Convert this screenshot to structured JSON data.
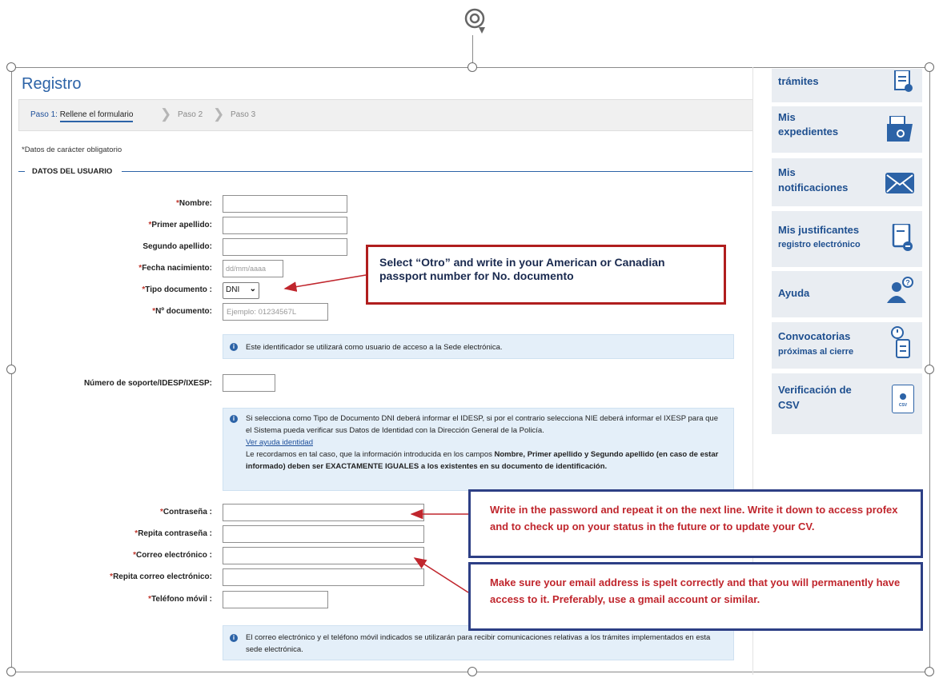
{
  "page_title": "Registro",
  "steps": {
    "step1_prefix": "Paso 1:",
    "step1_label": "Rellene el formulario",
    "step2": "Paso 2",
    "step3": "Paso 3"
  },
  "required_note": "*Datos de carácter obligatorio",
  "section_title": "DATOS DEL USUARIO",
  "fields": {
    "nombre": "Nombre:",
    "primer_apellido": "Primer apellido:",
    "segundo_apellido": "Segundo apellido:",
    "fecha_nacimiento": "Fecha nacimiento:",
    "fecha_placeholder": "dd/mm/aaaa",
    "tipo_documento": "Tipo documento :",
    "tipo_documento_value": "DNI",
    "num_documento": "Nº documento:",
    "num_documento_placeholder": "Ejemplo: 01234567L",
    "soporte": "Número de soporte/IDESP/IXESP:",
    "contrasena": "Contraseña :",
    "repita_contrasena": "Repita contraseña :",
    "correo": "Correo electrónico :",
    "repita_correo": "Repita correo electrónico:",
    "telefono": "Teléfono móvil :"
  },
  "info1": "Este identificador se utilizará como usuario de acceso a la Sede electrónica.",
  "info2": {
    "p1": "Si selecciona como Tipo de Documento DNI deberá informar el IDESP, si por el contrario selecciona NIE deberá informar el IXESP para que el Sistema pueda verificar sus Datos de Identidad con la Dirección General de la Policía.",
    "link": "Ver ayuda identidad",
    "p2a": "Le recordamos en tal caso, que la información introducida en los campos ",
    "p2b": "Nombre, Primer apellido y Segundo apellido (en caso de estar informado) deben ser EXACTAMENTE IGUALES a los existentes en su documento de identificación."
  },
  "info3": "El correo electrónico y el teléfono móvil indicados se utilizarán para recibir comunicaciones relativas a los trámites implementados en esta sede electrónica.",
  "sidebar": {
    "tramites": "trámites",
    "expedientes_1": "Mis",
    "expedientes_2": "expedientes",
    "notificaciones_1": "Mis",
    "notificaciones_2": "notificaciones",
    "justificantes_1": "Mis justificantes",
    "justificantes_2": "registro electrónico",
    "ayuda": "Ayuda",
    "convocatorias_1": "Convocatorias",
    "convocatorias_2": "próximas al cierre",
    "verificacion_1": "Verificación de",
    "verificacion_2": "CSV",
    "csv_icon_text": "CSV"
  },
  "annotations": {
    "red_line1": "Select “Otro” and write in your American or Canadian",
    "red_line2": "passport number for No. documento",
    "blue1": "Write in the password and repeat it on the next line. Write it down to access profex and to check up on your status in the future or to update your CV.",
    "blue2": "Make sure your email address is spelt correctly and that you will permanently have access to it. Preferably, use a gmail account or similar."
  },
  "colors": {
    "brand_blue": "#2c63a7",
    "required_red": "#c0362c",
    "annotation_red": "#b01e1e",
    "annotation_navy": "#2d3f85"
  }
}
